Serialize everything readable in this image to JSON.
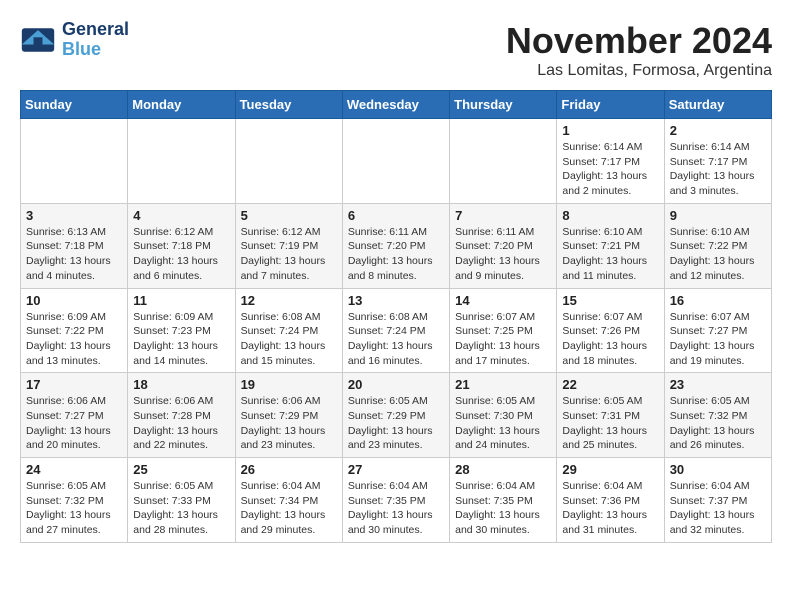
{
  "logo": {
    "line1": "General",
    "line2": "Blue"
  },
  "title": "November 2024",
  "location": "Las Lomitas, Formosa, Argentina",
  "weekdays": [
    "Sunday",
    "Monday",
    "Tuesday",
    "Wednesday",
    "Thursday",
    "Friday",
    "Saturday"
  ],
  "weeks": [
    [
      {
        "day": "",
        "info": ""
      },
      {
        "day": "",
        "info": ""
      },
      {
        "day": "",
        "info": ""
      },
      {
        "day": "",
        "info": ""
      },
      {
        "day": "",
        "info": ""
      },
      {
        "day": "1",
        "info": "Sunrise: 6:14 AM\nSunset: 7:17 PM\nDaylight: 13 hours\nand 2 minutes."
      },
      {
        "day": "2",
        "info": "Sunrise: 6:14 AM\nSunset: 7:17 PM\nDaylight: 13 hours\nand 3 minutes."
      }
    ],
    [
      {
        "day": "3",
        "info": "Sunrise: 6:13 AM\nSunset: 7:18 PM\nDaylight: 13 hours\nand 4 minutes."
      },
      {
        "day": "4",
        "info": "Sunrise: 6:12 AM\nSunset: 7:18 PM\nDaylight: 13 hours\nand 6 minutes."
      },
      {
        "day": "5",
        "info": "Sunrise: 6:12 AM\nSunset: 7:19 PM\nDaylight: 13 hours\nand 7 minutes."
      },
      {
        "day": "6",
        "info": "Sunrise: 6:11 AM\nSunset: 7:20 PM\nDaylight: 13 hours\nand 8 minutes."
      },
      {
        "day": "7",
        "info": "Sunrise: 6:11 AM\nSunset: 7:20 PM\nDaylight: 13 hours\nand 9 minutes."
      },
      {
        "day": "8",
        "info": "Sunrise: 6:10 AM\nSunset: 7:21 PM\nDaylight: 13 hours\nand 11 minutes."
      },
      {
        "day": "9",
        "info": "Sunrise: 6:10 AM\nSunset: 7:22 PM\nDaylight: 13 hours\nand 12 minutes."
      }
    ],
    [
      {
        "day": "10",
        "info": "Sunrise: 6:09 AM\nSunset: 7:22 PM\nDaylight: 13 hours\nand 13 minutes."
      },
      {
        "day": "11",
        "info": "Sunrise: 6:09 AM\nSunset: 7:23 PM\nDaylight: 13 hours\nand 14 minutes."
      },
      {
        "day": "12",
        "info": "Sunrise: 6:08 AM\nSunset: 7:24 PM\nDaylight: 13 hours\nand 15 minutes."
      },
      {
        "day": "13",
        "info": "Sunrise: 6:08 AM\nSunset: 7:24 PM\nDaylight: 13 hours\nand 16 minutes."
      },
      {
        "day": "14",
        "info": "Sunrise: 6:07 AM\nSunset: 7:25 PM\nDaylight: 13 hours\nand 17 minutes."
      },
      {
        "day": "15",
        "info": "Sunrise: 6:07 AM\nSunset: 7:26 PM\nDaylight: 13 hours\nand 18 minutes."
      },
      {
        "day": "16",
        "info": "Sunrise: 6:07 AM\nSunset: 7:27 PM\nDaylight: 13 hours\nand 19 minutes."
      }
    ],
    [
      {
        "day": "17",
        "info": "Sunrise: 6:06 AM\nSunset: 7:27 PM\nDaylight: 13 hours\nand 20 minutes."
      },
      {
        "day": "18",
        "info": "Sunrise: 6:06 AM\nSunset: 7:28 PM\nDaylight: 13 hours\nand 22 minutes."
      },
      {
        "day": "19",
        "info": "Sunrise: 6:06 AM\nSunset: 7:29 PM\nDaylight: 13 hours\nand 23 minutes."
      },
      {
        "day": "20",
        "info": "Sunrise: 6:05 AM\nSunset: 7:29 PM\nDaylight: 13 hours\nand 23 minutes."
      },
      {
        "day": "21",
        "info": "Sunrise: 6:05 AM\nSunset: 7:30 PM\nDaylight: 13 hours\nand 24 minutes."
      },
      {
        "day": "22",
        "info": "Sunrise: 6:05 AM\nSunset: 7:31 PM\nDaylight: 13 hours\nand 25 minutes."
      },
      {
        "day": "23",
        "info": "Sunrise: 6:05 AM\nSunset: 7:32 PM\nDaylight: 13 hours\nand 26 minutes."
      }
    ],
    [
      {
        "day": "24",
        "info": "Sunrise: 6:05 AM\nSunset: 7:32 PM\nDaylight: 13 hours\nand 27 minutes."
      },
      {
        "day": "25",
        "info": "Sunrise: 6:05 AM\nSunset: 7:33 PM\nDaylight: 13 hours\nand 28 minutes."
      },
      {
        "day": "26",
        "info": "Sunrise: 6:04 AM\nSunset: 7:34 PM\nDaylight: 13 hours\nand 29 minutes."
      },
      {
        "day": "27",
        "info": "Sunrise: 6:04 AM\nSunset: 7:35 PM\nDaylight: 13 hours\nand 30 minutes."
      },
      {
        "day": "28",
        "info": "Sunrise: 6:04 AM\nSunset: 7:35 PM\nDaylight: 13 hours\nand 30 minutes."
      },
      {
        "day": "29",
        "info": "Sunrise: 6:04 AM\nSunset: 7:36 PM\nDaylight: 13 hours\nand 31 minutes."
      },
      {
        "day": "30",
        "info": "Sunrise: 6:04 AM\nSunset: 7:37 PM\nDaylight: 13 hours\nand 32 minutes."
      }
    ]
  ]
}
